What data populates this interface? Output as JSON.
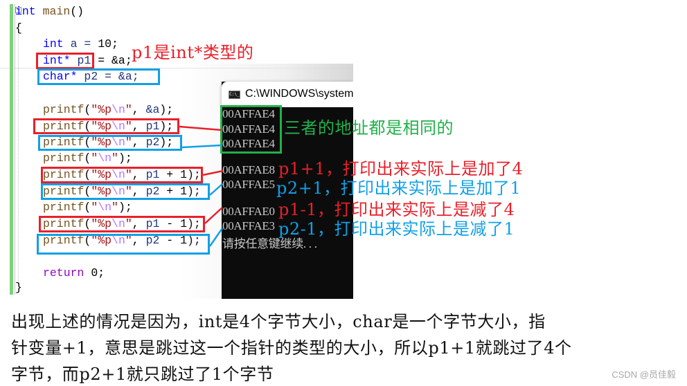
{
  "editor": {
    "fold_icon": "minus-box",
    "lines": [
      {
        "id": "l1",
        "text": "int main()"
      },
      {
        "id": "l2",
        "text": "{"
      },
      {
        "id": "l3",
        "text": "    int a = 10;"
      },
      {
        "id": "l4",
        "text": "    int* p1 = &a;"
      },
      {
        "id": "l5",
        "text": "    char* p2 = &a;"
      },
      {
        "id": "l6",
        "text": ""
      },
      {
        "id": "l7",
        "text": "    printf(\"%p\\n\", &a);"
      },
      {
        "id": "l8",
        "text": "    printf(\"%p\\n\", p1);"
      },
      {
        "id": "l9",
        "text": "    printf(\"%p\\n\", p2);"
      },
      {
        "id": "l10",
        "text": "    printf(\"\\n\");"
      },
      {
        "id": "l11",
        "text": "    printf(\"%p\\n\", p1 + 1);"
      },
      {
        "id": "l12",
        "text": "    printf(\"%p\\n\", p2 + 1);"
      },
      {
        "id": "l13",
        "text": "    printf(\"\\n\");"
      },
      {
        "id": "l14",
        "text": "    printf(\"%p\\n\", p1 - 1);"
      },
      {
        "id": "l15",
        "text": "    printf(\"%p\\n\", p2 - 1);"
      },
      {
        "id": "l16",
        "text": ""
      },
      {
        "id": "l17",
        "text": "    return 0;"
      },
      {
        "id": "l18",
        "text": "}"
      }
    ],
    "tokens": {
      "int": "int",
      "main": "main",
      "parens": "()",
      "lbrace": "{",
      "rbrace": "}",
      "a_decl_rest": " a = ",
      "ten": "10",
      "semi": ";",
      "intptr": "int*",
      "p1": "p1",
      "eq_amp_a": " = &a;",
      "charptr": "char*",
      "p2_eq_amp_a": " p2 = &a;",
      "printf": "printf",
      "lparen": "(",
      "q": "\"",
      "fmt": "%p",
      "nl": "\\n",
      "comma": ", ",
      "amp_a": "&a",
      "rparen_semi": ");",
      "p2": "p2",
      "plus_one": " + ",
      "minus_one": " - ",
      "one": "1",
      "return": "return",
      "zero": "0"
    }
  },
  "console": {
    "title": "C:\\WINDOWS\\system",
    "icon": "cmd-icon",
    "lines": [
      "00AFFAE4",
      "00AFFAE4",
      "00AFFAE4",
      "00AFFAE8",
      "00AFFAE5",
      "00AFFAE0",
      "00AFFAE3",
      "请按任意键继续. . ."
    ]
  },
  "annotations": {
    "p1_type": "p1是int*类型的",
    "same_address": "三者的地址都是相同的",
    "p1_plus": "p1+1，打印出来实际上是加了4",
    "p2_plus": "p2+1，打印出来实际上是加了1",
    "p1_minus": "p1-1，打印出来实际上是减了4",
    "p2_minus": "p2-1，打印出来实际上是减了1"
  },
  "explanation": {
    "line1": "出现上述的情况是因为，int是4个字节大小，char是一个字节大小，指",
    "line2": "针变量+1，意思是跳过这一个指针的类型的大小，所以p1+1就跳过了4个",
    "line3": "字节，而p2+1就只跳过了1个字节"
  },
  "watermark": "CSDN @员佳毅",
  "colors": {
    "red": "#e8202a",
    "blue": "#10a0e6",
    "green": "#22b04b",
    "console_bg": "#0c0c0c",
    "console_text": "#c8c8c8",
    "gutter_green": "#7ed27b"
  }
}
